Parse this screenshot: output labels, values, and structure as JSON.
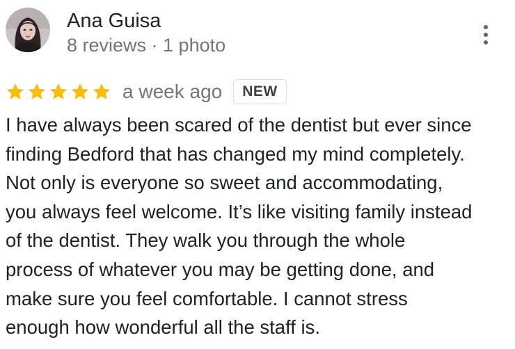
{
  "reviewer": {
    "name": "Ana Guisa",
    "meta": "8 reviews · 1 photo"
  },
  "review": {
    "rating": 5,
    "rating_max": 5,
    "date": "a week ago",
    "badge": "NEW",
    "text_lines": [
      "I have always been scared of the dentist but ever since",
      "finding Bedford that has changed my mind completely.",
      "Not only is everyone so sweet and accommodating,",
      "you always feel welcome. It’s like visiting family instead",
      "of the dentist. They walk you through the whole",
      "process of whatever you may be getting done, and",
      "make sure you feel comfortable. I cannot stress",
      "enough how wonderful all the staff is."
    ]
  },
  "icons": {
    "star": "star-icon",
    "more": "more-vert-icon",
    "avatar": "profile-photo"
  },
  "colors": {
    "star": "#fbbc04",
    "secondary_text": "#70757a",
    "primary_text": "#202124",
    "badge_border": "#dadce0"
  }
}
